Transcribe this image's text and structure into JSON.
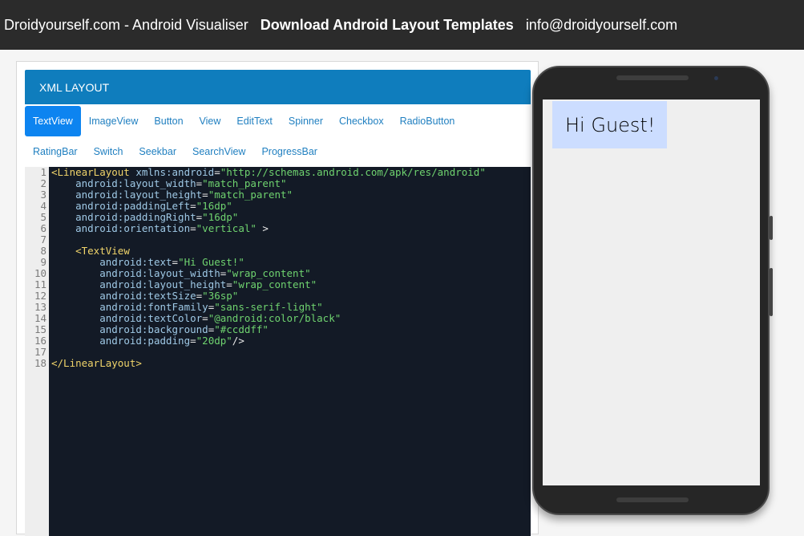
{
  "navbar": {
    "brand": "Droidyourself.com - Android Visualiser",
    "templates_link": "Download Android Layout Templates",
    "email": "info@droidyourself.com"
  },
  "panel": {
    "heading": "XML LAYOUT",
    "tabs_row1": [
      {
        "label": "TextView",
        "active": true
      },
      {
        "label": "ImageView",
        "active": false
      },
      {
        "label": "Button",
        "active": false
      },
      {
        "label": "View",
        "active": false
      },
      {
        "label": "EditText",
        "active": false
      },
      {
        "label": "Spinner",
        "active": false
      },
      {
        "label": "Checkbox",
        "active": false
      },
      {
        "label": "RadioButton",
        "active": false
      }
    ],
    "tabs_row2": [
      {
        "label": "RatingBar",
        "active": false
      },
      {
        "label": "Switch",
        "active": false
      },
      {
        "label": "Seekbar",
        "active": false
      },
      {
        "label": "SearchView",
        "active": false
      },
      {
        "label": "ProgressBar",
        "active": false
      }
    ]
  },
  "editor": {
    "line_numbers": [
      "1",
      "2",
      "3",
      "4",
      "5",
      "6",
      "7",
      "8",
      "9",
      "10",
      "11",
      "12",
      "13",
      "14",
      "15",
      "16",
      "17",
      "18"
    ],
    "lines": [
      [
        [
          "tag",
          "<LinearLayout "
        ],
        [
          "attr",
          "xmlns:android"
        ],
        [
          "plain",
          "="
        ],
        [
          "str",
          "\"http://schemas.android.com/apk/res/android\""
        ]
      ],
      [
        [
          "plain",
          "    "
        ],
        [
          "attr",
          "android:layout_width"
        ],
        [
          "plain",
          "="
        ],
        [
          "str",
          "\"match_parent\""
        ]
      ],
      [
        [
          "plain",
          "    "
        ],
        [
          "attr",
          "android:layout_height"
        ],
        [
          "plain",
          "="
        ],
        [
          "str",
          "\"match_parent\""
        ]
      ],
      [
        [
          "plain",
          "    "
        ],
        [
          "attr",
          "android:paddingLeft"
        ],
        [
          "plain",
          "="
        ],
        [
          "str",
          "\"16dp\""
        ]
      ],
      [
        [
          "plain",
          "    "
        ],
        [
          "attr",
          "android:paddingRight"
        ],
        [
          "plain",
          "="
        ],
        [
          "str",
          "\"16dp\""
        ]
      ],
      [
        [
          "plain",
          "    "
        ],
        [
          "attr",
          "android:orientation"
        ],
        [
          "plain",
          "="
        ],
        [
          "str",
          "\"vertical\""
        ],
        [
          "plain",
          " >"
        ]
      ],
      [
        [
          "plain",
          ""
        ]
      ],
      [
        [
          "plain",
          "    "
        ],
        [
          "tag",
          "<TextView"
        ]
      ],
      [
        [
          "plain",
          "        "
        ],
        [
          "attr",
          "android:text"
        ],
        [
          "plain",
          "="
        ],
        [
          "str",
          "\"Hi Guest!\""
        ]
      ],
      [
        [
          "plain",
          "        "
        ],
        [
          "attr",
          "android:layout_width"
        ],
        [
          "plain",
          "="
        ],
        [
          "str",
          "\"wrap_content\""
        ]
      ],
      [
        [
          "plain",
          "        "
        ],
        [
          "attr",
          "android:layout_height"
        ],
        [
          "plain",
          "="
        ],
        [
          "str",
          "\"wrap_content\""
        ]
      ],
      [
        [
          "plain",
          "        "
        ],
        [
          "attr",
          "android:textSize"
        ],
        [
          "plain",
          "="
        ],
        [
          "str",
          "\"36sp\""
        ]
      ],
      [
        [
          "plain",
          "        "
        ],
        [
          "attr",
          "android:fontFamily"
        ],
        [
          "plain",
          "="
        ],
        [
          "str",
          "\"sans-serif-light\""
        ]
      ],
      [
        [
          "plain",
          "        "
        ],
        [
          "attr",
          "android:textColor"
        ],
        [
          "plain",
          "="
        ],
        [
          "str",
          "\"@android:color/black\""
        ]
      ],
      [
        [
          "plain",
          "        "
        ],
        [
          "attr",
          "android:background"
        ],
        [
          "plain",
          "="
        ],
        [
          "str",
          "\"#ccddff\""
        ]
      ],
      [
        [
          "plain",
          "        "
        ],
        [
          "attr",
          "android:padding"
        ],
        [
          "plain",
          "="
        ],
        [
          "str",
          "\"20dp\""
        ],
        [
          "plain",
          "/>"
        ]
      ],
      [
        [
          "plain",
          ""
        ]
      ],
      [
        [
          "tag",
          "</LinearLayout>"
        ]
      ]
    ]
  },
  "preview": {
    "text": "Hi Guest!",
    "background": "#ccddff",
    "text_color": "#000000"
  }
}
